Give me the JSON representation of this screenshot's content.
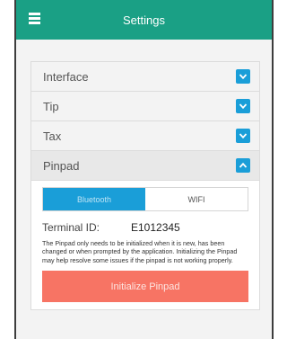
{
  "header": {
    "title": "Settings",
    "menu_icon": "hamburger-icon"
  },
  "colors": {
    "header": "#1aa085",
    "accent": "#1a9ed8",
    "danger": "#f77464"
  },
  "sections": [
    {
      "label": "Interface",
      "expanded": false,
      "icon": "chevron-down-icon"
    },
    {
      "label": "Tip",
      "expanded": false,
      "icon": "chevron-down-icon"
    },
    {
      "label": "Tax",
      "expanded": false,
      "icon": "chevron-down-icon"
    },
    {
      "label": "Pinpad",
      "expanded": true,
      "icon": "chevron-up-icon"
    }
  ],
  "pinpad": {
    "connection_options": [
      "Bluetooth",
      "WIFI"
    ],
    "selected_connection": "Bluetooth",
    "terminal_label": "Terminal ID:",
    "terminal_id": "E1012345",
    "note": "The Pinpad only needs to be initialized when it is new, has been changed or when prompted by the application. Initializing the Pinpad may help resolve some issues if the pinpad is not working properly.",
    "initialize_label": "Initialize Pinpad"
  }
}
